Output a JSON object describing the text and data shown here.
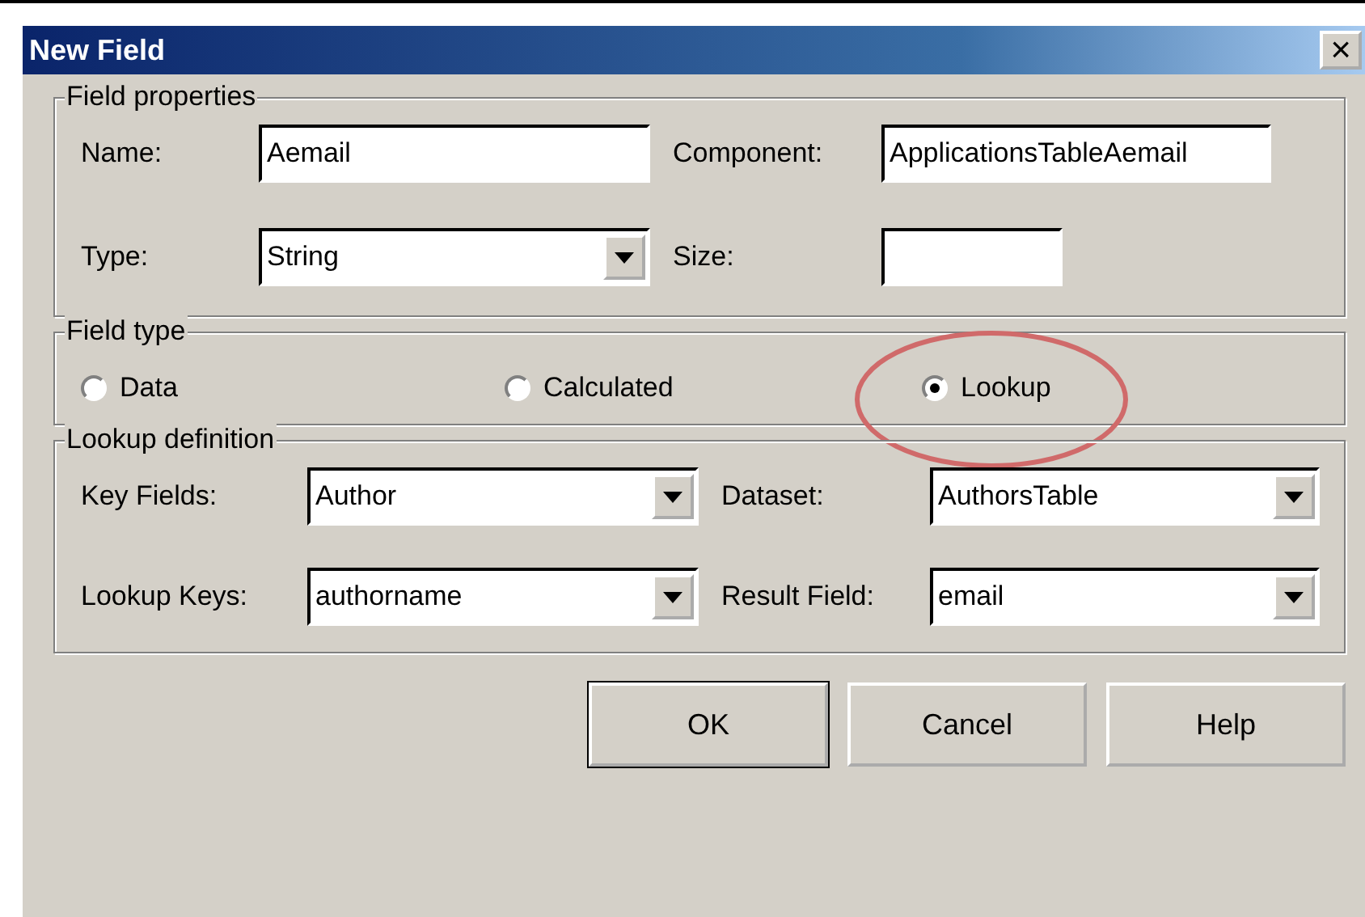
{
  "window": {
    "title": "New Field",
    "close": "×"
  },
  "field_properties": {
    "title": "Field properties",
    "fields": [
      {
        "label": "Name:",
        "kind": "text",
        "value": "Aemail"
      },
      {
        "label": "Component:",
        "kind": "text",
        "value": "ApplicationsTableAemail"
      },
      {
        "label": "Type:",
        "kind": "dropdown",
        "value": "String"
      },
      {
        "label": "Size:",
        "kind": "short"
      }
    ]
  },
  "field_type": {
    "title": "Field type",
    "options": [
      {
        "label": "Data",
        "selected": false
      },
      {
        "label": "Calculated",
        "selected": false
      },
      {
        "label": "Lookup",
        "selected": true,
        "highlighted": true
      }
    ]
  },
  "lookup_definition": {
    "title": "Lookup definition",
    "fields": [
      {
        "label": "Key Fields:",
        "kind": "dropdown",
        "value": "Author"
      },
      {
        "label": "Dataset:",
        "kind": "dropdown",
        "value": "AuthorsTable"
      },
      {
        "label": "Lookup Keys:",
        "kind": "dropdown",
        "value": "authorname"
      },
      {
        "label": "Result Field:",
        "kind": "dropdown",
        "value": "email"
      }
    ]
  },
  "buttons": [
    {
      "label": "OK",
      "default": true
    },
    {
      "label": "Cancel",
      "default": false
    },
    {
      "label": "Help",
      "default": false
    }
  ]
}
